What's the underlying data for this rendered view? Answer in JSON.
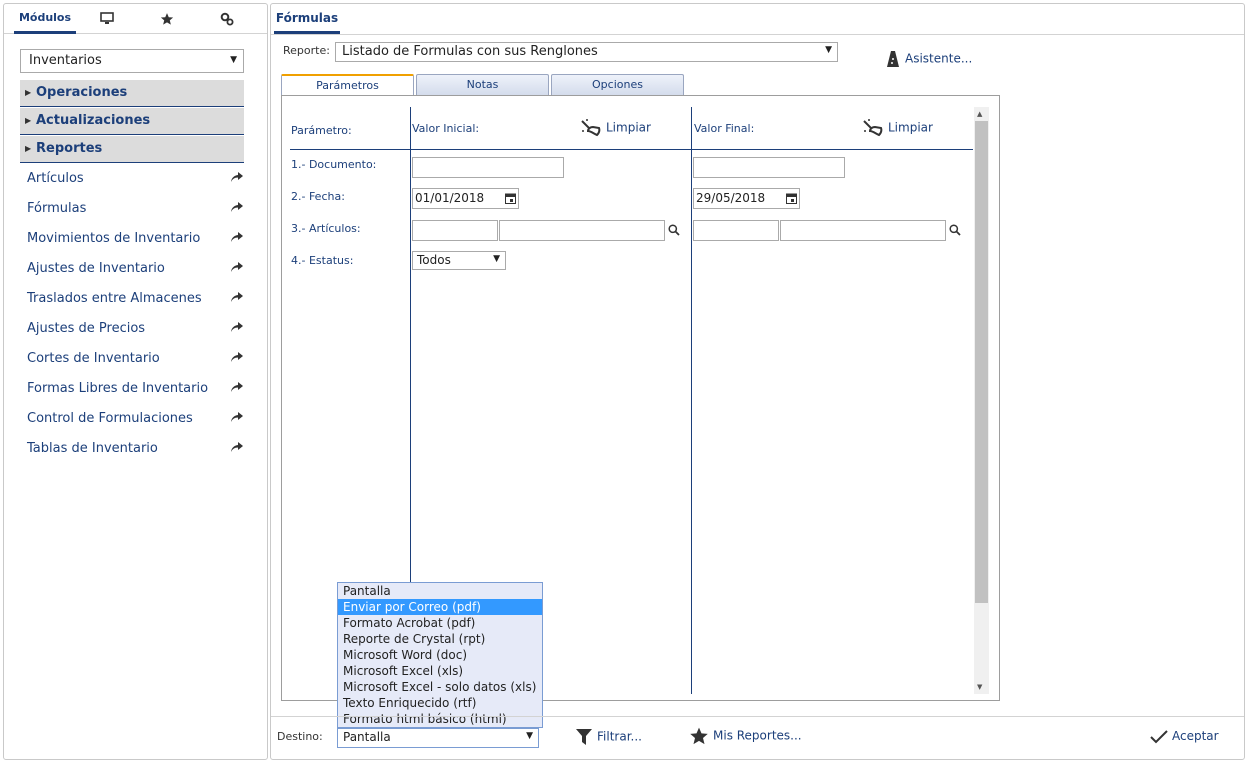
{
  "left": {
    "tabs": {
      "modules_label": "Módulos"
    },
    "module_select": {
      "value": "Inventarios"
    },
    "sections": [
      "Operaciones",
      "Actualizaciones",
      "Reportes"
    ],
    "items": [
      "Artículos",
      "Fórmulas",
      "Movimientos de Inventario",
      "Ajustes de Inventario",
      "Traslados entre Almacenes",
      "Ajustes de Precios",
      "Cortes de Inventario",
      "Formas Libres de Inventario",
      "Control de Formulaciones",
      "Tablas de Inventario"
    ]
  },
  "main": {
    "tab_title": "Fórmulas",
    "reporte_label": "Reporte:",
    "reporte_value": "Listado de Formulas con sus Renglones",
    "asistente_label": "Asistente...",
    "tabs": [
      "Parámetros",
      "Notas",
      "Opciones"
    ],
    "headers": {
      "parametro": "Parámetro:",
      "valor_inicial": "Valor Inicial:",
      "valor_final": "Valor Final:",
      "limpiar": "Limpiar"
    },
    "params": {
      "documento": "1.- Documento:",
      "fecha": "2.- Fecha:",
      "articulos": "3.- Artículos:",
      "estatus": "4.- Estatus:"
    },
    "values": {
      "fecha_inicial": "01/01/2018",
      "fecha_final": "29/05/2018",
      "estatus": "Todos"
    },
    "destino_options": [
      "Pantalla",
      "Enviar por Correo (pdf)",
      "Formato Acrobat (pdf)",
      "Reporte de Crystal (rpt)",
      "Microsoft Word (doc)",
      "Microsoft Excel (xls)",
      "Microsoft Excel - solo datos (xls)",
      "Texto Enriquecido (rtf)",
      "Formato html básico (html)"
    ],
    "destino_highlighted": "Enviar por Correo (pdf)"
  },
  "footer": {
    "destino_label": "Destino:",
    "destino_value": "Pantalla",
    "filtrar_label": "Filtrar...",
    "mis_reportes_label": "Mis Reportes...",
    "aceptar_label": "Aceptar"
  },
  "colors": {
    "accent": "#1c3f7a",
    "tab_highlight": "#f0a000",
    "selection": "#3399ff"
  }
}
